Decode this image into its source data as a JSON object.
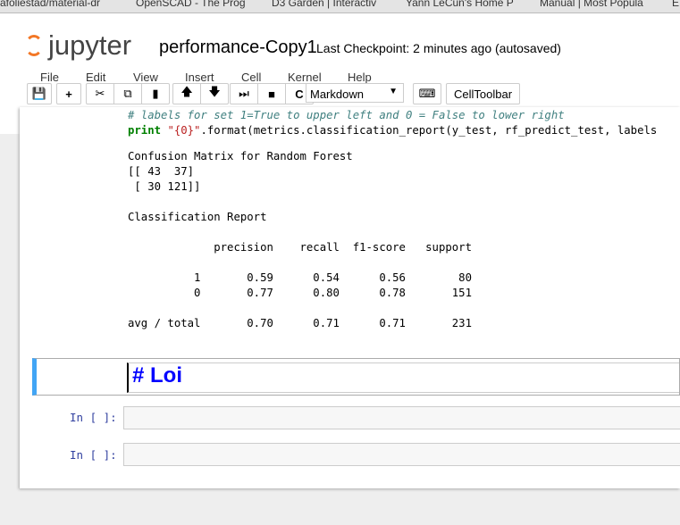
{
  "browser_tabs": [
    "afoliestad/material-dr",
    "OpenSCAD - The Prog",
    "D3 Garden | Interactiv",
    "Yann LeCun's Home P",
    "Manual | Most Popula",
    "E"
  ],
  "header": {
    "logo": "jupyter",
    "notebook_name": "performance-Copy1",
    "checkpoint": "Last Checkpoint: 2 minutes ago (autosaved)"
  },
  "menu": [
    "File",
    "Edit",
    "View",
    "Insert",
    "Cell",
    "Kernel",
    "Help"
  ],
  "toolbar": {
    "cell_type": "Markdown",
    "celltoolbar": "CellToolbar",
    "icons": [
      "save-icon",
      "plus-icon",
      "cut-icon",
      "copy-icon",
      "paste-icon",
      "arrow-up-icon",
      "arrow-down-icon",
      "step-forward-icon",
      "stop-icon",
      "restart-icon",
      "keyboard-icon"
    ]
  },
  "code": {
    "comment": "# labels for set 1=True to upper left and 0 = False to lower right",
    "kw": "print",
    "str": "\"{0}\"",
    "rest": ".format(metrics.classification_report(y_test, rf_predict_test, labels"
  },
  "output": "Confusion Matrix for Random Forest\n[[ 43  37]\n [ 30 121]]\n\nClassification Report\n\n             precision    recall  f1-score   support\n\n          1       0.59      0.54      0.56        80\n          0       0.77      0.80      0.78       151\n\navg / total       0.70      0.71      0.71       231",
  "markdown_cell": "# Loi",
  "prompts": [
    "In [ ]:",
    "In [ ]:"
  ]
}
